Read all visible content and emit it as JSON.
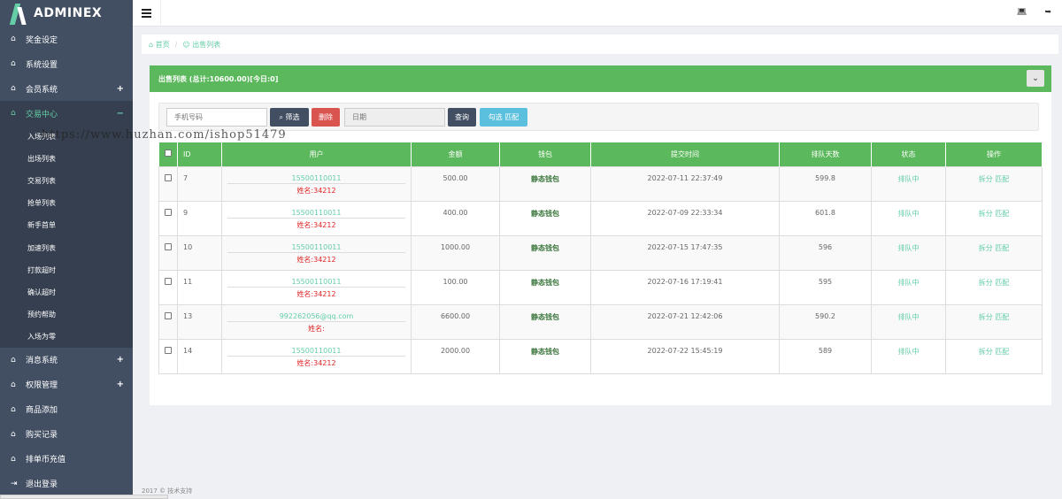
{
  "app": {
    "logo_text": "ADMINEX",
    "logo_accent": "#65cea7"
  },
  "sidebar": {
    "items": [
      {
        "label": "奖金设定",
        "icon": "home-icon"
      },
      {
        "label": "系统设置",
        "icon": "home-icon"
      },
      {
        "label": "会员系统",
        "icon": "home-icon",
        "expander": "+"
      },
      {
        "label": "交易中心",
        "icon": "home-icon",
        "expander": "−"
      }
    ],
    "sub_items": [
      "入场列表",
      "出场列表",
      "交易列表",
      "抢单列表",
      "新手首单",
      "加速列表",
      "打款超时",
      "确认超时",
      "预约帮助",
      "入场为零"
    ],
    "items_after": [
      {
        "label": "消息系统",
        "icon": "home-icon",
        "expander": "+"
      },
      {
        "label": "权限管理",
        "icon": "home-icon",
        "expander": "+"
      },
      {
        "label": "商品添加",
        "icon": "home-icon"
      },
      {
        "label": "购买记录",
        "icon": "home-icon"
      },
      {
        "label": "排单币充值",
        "icon": "home-icon"
      },
      {
        "label": "退出登录",
        "icon": "logout-icon"
      }
    ]
  },
  "breadcrumb": {
    "home": "首页",
    "separator": "/",
    "current": "出售列表"
  },
  "panel": {
    "title": "出售列表 (总计:10600.00)[今日:0]"
  },
  "toolbar": {
    "phone_placeholder": "手机号码",
    "filter_label": "筛选",
    "delete_label": "删除",
    "date_placeholder": "日期",
    "query_label": "查询",
    "match_label": "勾选 匹配"
  },
  "table": {
    "headers": [
      "ID",
      "用户",
      "金额",
      "钱包",
      "提交时间",
      "排队天数",
      "状态",
      "操作"
    ],
    "rows": [
      {
        "id": "7",
        "user": "15500110011",
        "name": "姓名:34212",
        "amount": "500.00",
        "wallet": "静态钱包",
        "time": "2022-07-11 22:37:49",
        "days": "599.8",
        "status": "排队中",
        "ops": "拆分 匹配"
      },
      {
        "id": "9",
        "user": "15500110011",
        "name": "姓名:34212",
        "amount": "400.00",
        "wallet": "静态钱包",
        "time": "2022-07-09 22:33:34",
        "days": "601.8",
        "status": "排队中",
        "ops": "拆分 匹配"
      },
      {
        "id": "10",
        "user": "15500110011",
        "name": "姓名:34212",
        "amount": "1000.00",
        "wallet": "静态钱包",
        "time": "2022-07-15 17:47:35",
        "days": "596",
        "status": "排队中",
        "ops": "拆分 匹配"
      },
      {
        "id": "11",
        "user": "15500110011",
        "name": "姓名:34212",
        "amount": "100.00",
        "wallet": "静态钱包",
        "time": "2022-07-16 17:19:41",
        "days": "595",
        "status": "排队中",
        "ops": "拆分 匹配"
      },
      {
        "id": "13",
        "user": "992262056@qq.com",
        "name": "姓名:",
        "amount": "6600.00",
        "wallet": "静态钱包",
        "time": "2022-07-21 12:42:06",
        "days": "590.2",
        "status": "排队中",
        "ops": "拆分 匹配"
      },
      {
        "id": "14",
        "user": "15500110011",
        "name": "姓名:34212",
        "amount": "2000.00",
        "wallet": "静态钱包",
        "time": "2022-07-22 15:45:19",
        "days": "589",
        "status": "排队中",
        "ops": "拆分 匹配"
      }
    ]
  },
  "footer": {
    "text": "2017 © 技术支持"
  },
  "watermark": "https://www.huzhan.com/ishop51479",
  "colors": {
    "sidebar": "#424f63",
    "green": "#5cb85c",
    "accent": "#65cea7",
    "danger": "#d9534f",
    "info": "#5bc0de",
    "dark": "#424f63"
  }
}
